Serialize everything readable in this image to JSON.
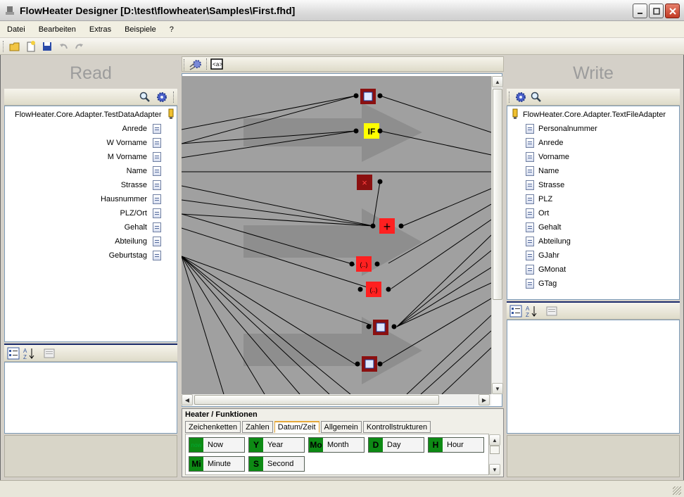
{
  "window": {
    "title": "FlowHeater Designer [D:\\test\\flowheater\\Samples\\First.fhd]"
  },
  "menu": [
    "Datei",
    "Bearbeiten",
    "Extras",
    "Beispiele",
    "?"
  ],
  "read_panel": {
    "title": "Read",
    "adapter": "FlowHeater.Core.Adapter.TestDataAdapter",
    "fields": [
      "Anrede",
      "W Vorname",
      "M Vorname",
      "Name",
      "Strasse",
      "Hausnummer",
      "PLZ/Ort",
      "Gehalt",
      "Abteilung",
      "Geburtstag"
    ]
  },
  "write_panel": {
    "title": "Write",
    "adapter": "FlowHeater.Core.Adapter.TextFileAdapter",
    "fields": [
      "Personalnummer",
      "Anrede",
      "Vorname",
      "Name",
      "Strasse",
      "PLZ",
      "Ort",
      "Gehalt",
      "Abteilung",
      "GJahr",
      "GMonat",
      "GTag"
    ]
  },
  "canvas": {
    "if_label": "IF",
    "plus_label": "+",
    "x_label": "×",
    "paren_label": "(..)"
  },
  "heater": {
    "title": "Heater / Funktionen",
    "tabs": [
      "Zeichenketten",
      "Zahlen",
      "Datum/Zeit",
      "Allgemein",
      "Kontrollstrukturen"
    ],
    "active_tab": "Datum/Zeit",
    "functions": [
      {
        "tag": "now",
        "label": "Now"
      },
      {
        "tag": "Y",
        "label": "Year"
      },
      {
        "tag": "Mo",
        "label": "Month"
      },
      {
        "tag": "D",
        "label": "Day"
      },
      {
        "tag": "H",
        "label": "Hour"
      },
      {
        "tag": "Mi",
        "label": "Minute"
      },
      {
        "tag": "S",
        "label": "Second"
      }
    ]
  },
  "colors": {
    "heater_green": "#0d8a14",
    "node_red": "#ff2020",
    "node_darkred": "#8b1010",
    "if_yellow": "#ffff00",
    "canvas_bg": "#a0a0a0"
  }
}
